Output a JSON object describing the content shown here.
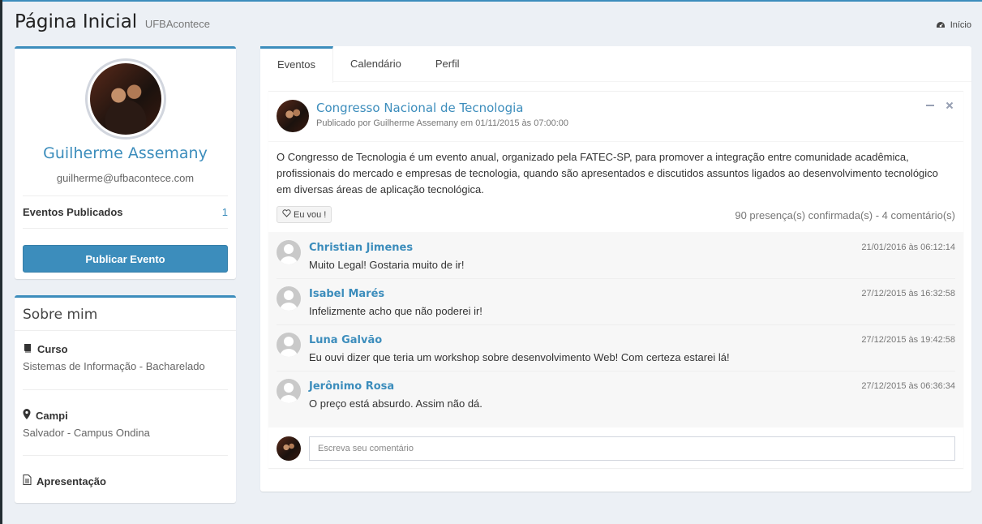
{
  "header": {
    "title": "Página Inicial",
    "subtitle": "UFBAcontece",
    "breadcrumb": "Início"
  },
  "profile": {
    "name": "Guilherme Assemany",
    "email": "guilherme@ufbacontece.com",
    "stat_label": "Eventos Publicados",
    "stat_value": "1",
    "publish_button": "Publicar Evento"
  },
  "about": {
    "title": "Sobre mim",
    "items": [
      {
        "label": "Curso",
        "value": "Sistemas de Informação - Bacharelado",
        "icon": "book-icon"
      },
      {
        "label": "Campi",
        "value": "Salvador - Campus Ondina",
        "icon": "map-marker-icon"
      },
      {
        "label": "Apresentação",
        "value": "",
        "icon": "file-text-icon"
      }
    ]
  },
  "tabs": [
    {
      "label": "Eventos",
      "active": true
    },
    {
      "label": "Calendário",
      "active": false
    },
    {
      "label": "Perfil",
      "active": false
    }
  ],
  "post": {
    "title": "Congresso Nacional de Tecnologia",
    "meta": "Publicado por Guilherme Assemany em 01/11/2015 às 07:00:00",
    "body": "O Congresso de Tecnologia é um evento anual, organizado pela FATEC-SP, para promover a integração entre comunidade acadêmica, profissionais do mercado e empresas de tecnologia, quando são apresentados e discutidos assuntos ligados ao desenvolvimento tecnológico em diversas áreas de aplicação tecnológica.",
    "like_button": "Eu vou !",
    "stats": "90 presença(s) confirmada(s) - 4 comentário(s)"
  },
  "comments": [
    {
      "name": "Christian Jimenes",
      "date": "21/01/2016 às 06:12:14",
      "text": "Muito Legal! Gostaria muito de ir!"
    },
    {
      "name": "Isabel Marés",
      "date": "27/12/2015 às 16:32:58",
      "text": "Infelizmente acho que não poderei ir!"
    },
    {
      "name": "Luna Galvão",
      "date": "27/12/2015 às 19:42:58",
      "text": "Eu ouvi dizer que teria um workshop sobre desenvolvimento Web! Com certeza estarei lá!"
    },
    {
      "name": "Jerônimo Rosa",
      "date": "27/12/2015 às 06:36:34",
      "text": "O preço está absurdo. Assim não dá."
    }
  ],
  "reply": {
    "placeholder": "Escreva seu comentário"
  },
  "colors": {
    "accent": "#3c8dbc",
    "background": "#ecf0f5"
  }
}
